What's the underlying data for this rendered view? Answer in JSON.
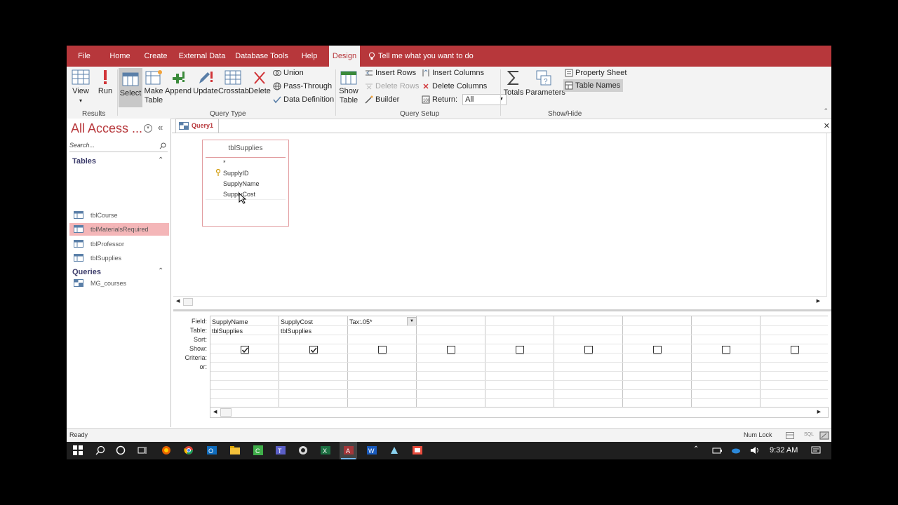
{
  "tabs": [
    "File",
    "Home",
    "Create",
    "External Data",
    "Database Tools",
    "Help",
    "Design"
  ],
  "tell_me": "Tell me what you want to do",
  "ribbon": {
    "results": {
      "view": "View",
      "run": "Run",
      "label": "Results"
    },
    "query_type": {
      "select": "Select",
      "make_table": "Make Table",
      "append": "Append",
      "update": "Update",
      "crosstab": "Crosstab",
      "delete": "Delete",
      "union": "Union",
      "pass_through": "Pass-Through",
      "data_definition": "Data Definition",
      "label": "Query Type"
    },
    "query_setup": {
      "show_table": "Show Table",
      "insert_rows": "Insert Rows",
      "delete_rows": "Delete Rows",
      "builder": "Builder",
      "insert_columns": "Insert Columns",
      "delete_columns": "Delete Columns",
      "return_label": "Return:",
      "return_value": "All",
      "label": "Query Setup"
    },
    "show_hide": {
      "totals": "Totals",
      "parameters": "Parameters",
      "property_sheet": "Property Sheet",
      "table_names": "Table Names",
      "label": "Show/Hide"
    }
  },
  "nav": {
    "title": "All Access ...",
    "search_placeholder": "Search...",
    "sections": [
      {
        "name": "Tables",
        "items": [
          "tblCourse",
          "tblMaterialsRequired",
          "tblProfessor",
          "tblSupplies"
        ]
      },
      {
        "name": "Queries",
        "items": [
          "MG_courses"
        ]
      }
    ]
  },
  "document": {
    "tab": "Query1"
  },
  "field_list": {
    "title": "tblSupplies",
    "fields": [
      "*",
      "SupplyID",
      "SupplyName",
      "SupplyCost"
    ]
  },
  "grid": {
    "row_labels": [
      "Field:",
      "Table:",
      "Sort:",
      "Show:",
      "Criteria:",
      "or:"
    ],
    "columns": [
      {
        "field": "SupplyName",
        "table": "tblSupplies",
        "show": true
      },
      {
        "field": "SupplyCost",
        "table": "tblSupplies",
        "show": true
      },
      {
        "field": "Tax:.05*",
        "table": "",
        "show": false
      },
      {
        "field": "",
        "table": "",
        "show": false
      },
      {
        "field": "",
        "table": "",
        "show": false
      },
      {
        "field": "",
        "table": "",
        "show": false
      },
      {
        "field": "",
        "table": "",
        "show": false
      },
      {
        "field": "",
        "table": "",
        "show": false
      },
      {
        "field": "",
        "table": "",
        "show": false
      }
    ]
  },
  "status": {
    "left": "Ready",
    "num_lock": "Num Lock",
    "sql": "SQL"
  },
  "taskbar": {
    "time": "9:32 AM"
  },
  "colors": {
    "accent": "#b7373b",
    "selected_nav": "#f4b6b8"
  }
}
